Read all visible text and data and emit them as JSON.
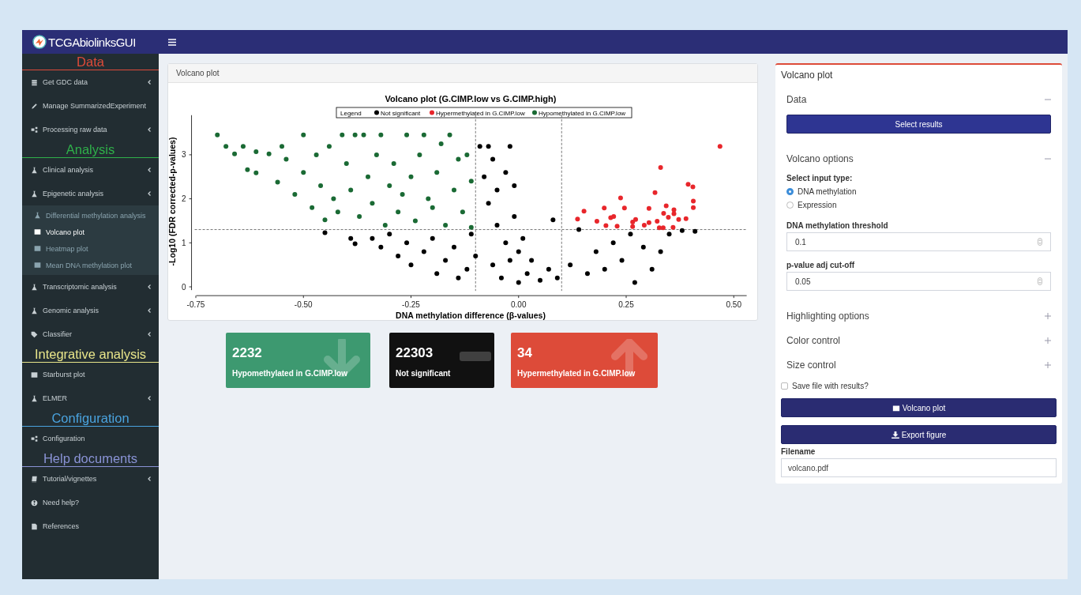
{
  "header": {
    "logo_text": "TCGAbiolinksGUI"
  },
  "sidebar": {
    "sections": [
      {
        "title": "Data",
        "color": "#dd4b39",
        "items": [
          {
            "label": "Get GDC data",
            "kind": "database",
            "has_submenu": true
          },
          {
            "label": "Manage SummarizedExperiment",
            "kind": "pencil",
            "has_submenu": false
          },
          {
            "label": "Processing raw data",
            "kind": "gears",
            "has_submenu": true
          }
        ]
      },
      {
        "title": "Analysis",
        "color": "#2fb04a",
        "items": [
          {
            "label": "Clinical analysis",
            "kind": "flask",
            "has_submenu": true
          },
          {
            "label": "Epigenetic analysis",
            "kind": "flask",
            "has_submenu": true,
            "children": [
              {
                "label": "Differential methylation analysis",
                "kind": "flask",
                "selected": false
              },
              {
                "label": "Volcano plot",
                "kind": "image",
                "selected": true
              },
              {
                "label": "Heatmap plot",
                "kind": "image",
                "selected": false
              },
              {
                "label": "Mean DNA methylation plot",
                "kind": "image",
                "selected": false
              }
            ]
          },
          {
            "label": "Transcriptomic analysis",
            "kind": "flask",
            "has_submenu": true
          },
          {
            "label": "Genomic analysis",
            "kind": "flask",
            "has_submenu": true
          },
          {
            "label": "Classifier",
            "kind": "tags",
            "has_submenu": true
          }
        ]
      },
      {
        "title": "Integrative analysis",
        "color": "#e8e58a",
        "items": [
          {
            "label": "Starburst plot",
            "kind": "image",
            "has_submenu": false
          },
          {
            "label": "ELMER",
            "kind": "flask",
            "has_submenu": true
          }
        ]
      },
      {
        "title": "Configuration",
        "color": "#4aa3df",
        "items": [
          {
            "label": "Configuration",
            "kind": "gears",
            "has_submenu": false
          }
        ]
      },
      {
        "title": "Help documents",
        "color": "#8a93d6",
        "items": [
          {
            "label": "Tutorial/vignettes",
            "kind": "book",
            "has_submenu": true
          },
          {
            "label": "Need help?",
            "kind": "question",
            "has_submenu": false
          },
          {
            "label": "References",
            "kind": "file",
            "has_submenu": false
          }
        ]
      }
    ]
  },
  "plot_panel": {
    "title": "Volcano plot",
    "legend_title": "Legend",
    "chart_data": {
      "type": "scatter",
      "title": "Volcano plot (G.CIMP.low vs G.CIMP.high)",
      "xlabel": "DNA methylation difference (β-values)",
      "ylabel": "-Log10 (FDR corrected-p-values)",
      "legend": "top",
      "xlim": [
        -0.76,
        0.53
      ],
      "ylim": [
        -0.2,
        3.9
      ],
      "xticks": [
        {
          "value": -0.75,
          "label": "-0.75"
        },
        {
          "value": -0.5,
          "label": "-0.50"
        },
        {
          "value": -0.25,
          "label": "-0.25"
        },
        {
          "value": 0,
          "label": "0.00"
        },
        {
          "value": 0.25,
          "label": "0.25"
        },
        {
          "value": 0.5,
          "label": "0.50"
        }
      ],
      "yticks": [
        0,
        1,
        2,
        3
      ],
      "series": [
        {
          "name": "Not significant",
          "color": "#000000",
          "x": [
            -0.45,
            -0.39,
            -0.38,
            -0.34,
            -0.32,
            -0.3,
            -0.28,
            -0.26,
            -0.25,
            -0.22,
            -0.2,
            -0.19,
            -0.17,
            -0.15,
            -0.14,
            -0.12,
            -0.11,
            -0.1,
            -0.09,
            -0.08,
            -0.07,
            -0.07,
            -0.06,
            -0.06,
            -0.05,
            -0.05,
            -0.04,
            -0.03,
            -0.03,
            -0.02,
            -0.02,
            -0.01,
            -0.01,
            0.0,
            0.0,
            0.01,
            0.02,
            0.03,
            0.05,
            0.07,
            0.08,
            0.09,
            0.12,
            0.14,
            0.16,
            0.18,
            0.2,
            0.22,
            0.24,
            0.26,
            0.27,
            0.29,
            0.31,
            0.33,
            0.35,
            0.38,
            0.41
          ],
          "values": [
            1.23,
            1.1,
            0.98,
            1.1,
            0.9,
            1.2,
            0.7,
            1.0,
            0.5,
            0.8,
            1.1,
            0.3,
            0.6,
            0.9,
            0.2,
            0.4,
            1.2,
            0.7,
            3.19,
            2.5,
            3.19,
            1.9,
            2.9,
            0.5,
            2.2,
            1.4,
            0.2,
            2.6,
            1.0,
            3.19,
            0.6,
            2.3,
            1.6,
            0.8,
            0.1,
            1.1,
            0.3,
            0.6,
            0.15,
            0.4,
            1.52,
            0.2,
            0.5,
            1.3,
            0.3,
            0.8,
            0.4,
            1.0,
            0.6,
            1.2,
            0.1,
            0.9,
            0.4,
            0.8,
            1.2,
            1.28,
            1.26
          ]
        },
        {
          "name": "Hypermethylated in G.CIMP.low",
          "color": "#e8262b",
          "x": [
            0.468,
            0.33,
            0.317,
            0.237,
            0.246,
            0.199,
            0.152,
            0.137,
            0.182,
            0.214,
            0.221,
            0.203,
            0.229,
            0.265,
            0.272,
            0.265,
            0.292,
            0.303,
            0.303,
            0.322,
            0.327,
            0.336,
            0.337,
            0.343,
            0.348,
            0.361,
            0.361,
            0.359,
            0.372,
            0.389,
            0.394,
            0.405,
            0.406,
            0.406
          ],
          "values": [
            3.19,
            2.71,
            2.14,
            2.02,
            1.79,
            1.79,
            1.72,
            1.54,
            1.49,
            1.57,
            1.6,
            1.39,
            1.38,
            1.47,
            1.53,
            1.37,
            1.4,
            1.46,
            1.78,
            1.49,
            1.34,
            1.34,
            1.67,
            1.84,
            1.58,
            1.66,
            1.75,
            1.35,
            1.53,
            1.55,
            2.33,
            2.27,
            1.95,
            1.8
          ]
        },
        {
          "name": "Hypomethylated in G.CIMP.low",
          "color": "#1a6a34",
          "x": [
            -0.7,
            -0.68,
            -0.66,
            -0.64,
            -0.63,
            -0.61,
            -0.61,
            -0.58,
            -0.56,
            -0.55,
            -0.54,
            -0.52,
            -0.5,
            -0.5,
            -0.48,
            -0.47,
            -0.46,
            -0.45,
            -0.44,
            -0.43,
            -0.42,
            -0.41,
            -0.4,
            -0.39,
            -0.38,
            -0.37,
            -0.36,
            -0.35,
            -0.34,
            -0.33,
            -0.32,
            -0.31,
            -0.3,
            -0.29,
            -0.28,
            -0.27,
            -0.26,
            -0.25,
            -0.24,
            -0.23,
            -0.22,
            -0.21,
            -0.2,
            -0.19,
            -0.18,
            -0.17,
            -0.16,
            -0.15,
            -0.14,
            -0.13,
            -0.12,
            -0.11,
            -0.11
          ],
          "values": [
            3.45,
            3.19,
            3.02,
            3.19,
            2.66,
            2.59,
            3.07,
            3.02,
            2.38,
            3.19,
            2.9,
            2.1,
            3.45,
            2.6,
            1.8,
            3.0,
            2.3,
            1.52,
            3.19,
            2.0,
            1.7,
            3.45,
            2.8,
            2.2,
            3.45,
            1.6,
            3.45,
            2.5,
            1.9,
            3.0,
            3.45,
            1.4,
            2.3,
            2.8,
            1.7,
            2.1,
            3.45,
            2.5,
            1.5,
            3.0,
            3.45,
            2.0,
            1.8,
            2.6,
            3.25,
            1.4,
            3.45,
            2.2,
            2.9,
            1.7,
            3.0,
            2.4,
            1.35
          ]
        }
      ]
    }
  },
  "value_boxes": [
    {
      "value": "2232",
      "label": "Hypomethylated in G.CIMP.low",
      "kind": "down",
      "color": "#3d9970"
    },
    {
      "value": "22303",
      "label": "Not significant",
      "kind": "flat",
      "color": "#111111"
    },
    {
      "value": "34",
      "label": "Hypermethylated in G.CIMP.low",
      "kind": "up",
      "color": "#dd4b39"
    }
  ],
  "options_panel": {
    "title": "Volcano plot",
    "sections": [
      {
        "title": "Data",
        "expanded": true,
        "kind": "data",
        "button": "Select results"
      },
      {
        "title": "Volcano options",
        "expanded": true,
        "kind": "options",
        "radio_label": "Select input type:",
        "radios": [
          {
            "label": "DNA methylation",
            "selected": true
          },
          {
            "label": "Expression",
            "selected": false
          }
        ],
        "inputs": [
          {
            "label": "DNA methylation threshold",
            "value": "0.1"
          },
          {
            "label": "p-value adj cut-off",
            "value": "0.05"
          }
        ]
      },
      {
        "title": "Highlighting options",
        "expanded": false
      },
      {
        "title": "Color control",
        "expanded": false
      },
      {
        "title": "Size control",
        "expanded": false
      }
    ],
    "save_checkbox": {
      "label": "Save file with results?",
      "checked": false
    },
    "plot_button": "Volcano plot",
    "export_button": "Export figure",
    "filename": {
      "label": "Filename",
      "value": "volcano.pdf"
    }
  }
}
